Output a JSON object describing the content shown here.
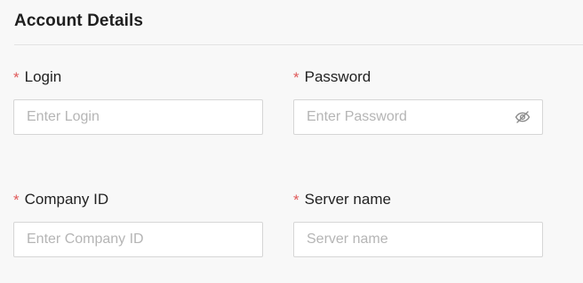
{
  "section": {
    "title": "Account Details"
  },
  "fields": {
    "login": {
      "required_mark": "*",
      "label": "Login",
      "value": "",
      "placeholder": "Enter Login"
    },
    "password": {
      "required_mark": "*",
      "label": "Password",
      "value": "",
      "placeholder": "Enter Password",
      "visibility_icon": "eye-off-icon"
    },
    "company_id": {
      "required_mark": "*",
      "label": "Company ID",
      "value": "",
      "placeholder": "Enter Company ID"
    },
    "server_name": {
      "required_mark": "*",
      "label": "Server name",
      "value": "",
      "placeholder": "Server name"
    }
  },
  "colors": {
    "background": "#f8f8f8",
    "required": "#e05a5a",
    "input_border": "#d6d6d6",
    "placeholder": "#b5b5b5"
  }
}
